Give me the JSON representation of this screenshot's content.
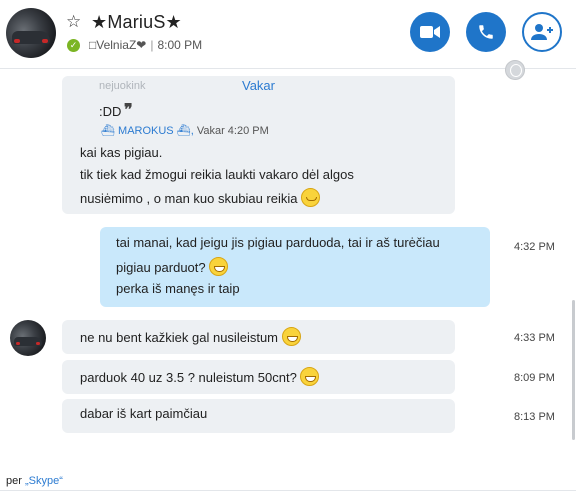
{
  "contact": {
    "name": "★MariuS★",
    "mood": "□VelniaZ❤",
    "last_seen": "8:00 PM",
    "separator": "|"
  },
  "header_buttons": [
    "video-call",
    "audio-call",
    "add-people"
  ],
  "date_separator": "Vakar",
  "quoted_message": {
    "name_partial": "nejuokink",
    "text": ":DD",
    "quote_mark": "❞",
    "author": "MAROKUS",
    "time": "Vakar 4:20 PM"
  },
  "first_bubble": {
    "line1": "kai kas pigiau.",
    "line2": "tik tiek kad žmogui reikia laukti vakaro dėl algos",
    "line3": "nusiėmimo , o man kuo skubiau reikia"
  },
  "outgoing": {
    "line1": "tai manai, kad jeigu jis pigiau parduoda, tai ir aš turėčiau",
    "line2": "pigiau parduot?",
    "line3": "perka iš manęs ir taip",
    "time": "4:32 PM"
  },
  "messages": [
    {
      "text": "ne nu bent kažkiek gal nusileistum",
      "time": "4:33 PM"
    },
    {
      "text": "parduok 40 uz 3.5 ? nuleistum 50cnt?",
      "time": "8:09 PM"
    },
    {
      "text": "dabar iš kart paimčiau",
      "time": "8:13 PM"
    }
  ],
  "footer": {
    "prefix": "per ",
    "link": "„Skype“"
  }
}
